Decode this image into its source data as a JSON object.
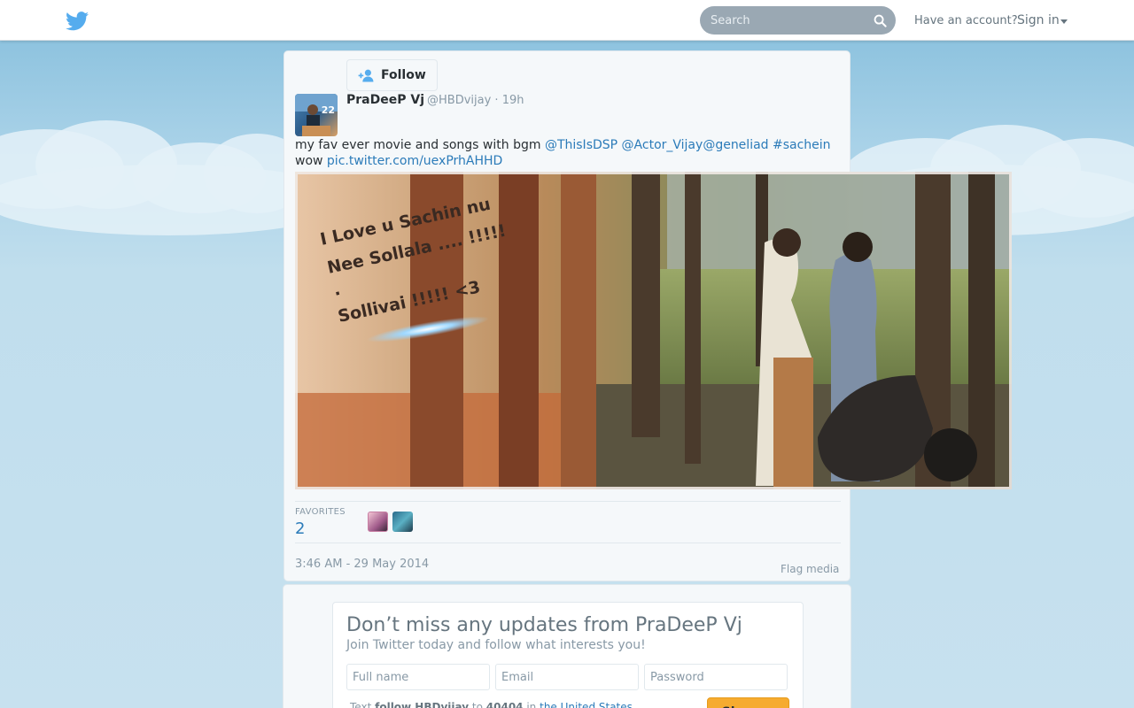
{
  "topbar": {
    "search": {
      "placeholder": "Search"
    },
    "have_account": "Have an account?",
    "signin_label": "Sign in"
  },
  "tweet": {
    "follow_label": "Follow",
    "fullname": "PraDeeP Vj",
    "username": "@HBDvijay",
    "time_ago": "19h",
    "avatar_number": "22",
    "text_plain_1": "my fav ever movie and songs with bgm ",
    "mention_1": "@ThisIsDSP",
    "mention_2": "@Actor_Vijay",
    "mention_3": "@geneliad",
    "hashtag": "#sachein",
    "text_plain_2": "wow ",
    "pic_link": "pic.twitter.com/uexPrhAHHD",
    "media_overlay_lines": [
      "I Love u Sachin nu",
      "Nee Sollala .... !!!!!",
      ".",
      "Sollivai !!!!! <3"
    ],
    "favorites_label": "FAVORITES",
    "favorites_count": "2",
    "timestamp": "3:46 AM - 29 May 2014",
    "flag_label": "Flag media"
  },
  "signup": {
    "title": "Don’t miss any updates from PraDeeP Vj",
    "subtitle": "Join Twitter today and follow what interests you!",
    "fullname_placeholder": "Full name",
    "email_placeholder": "Email",
    "password_placeholder": "Password",
    "sms_text": "Text",
    "sms_command": "follow HBDvijay",
    "sms_to": "to",
    "sms_number": "40404",
    "sms_in": "in",
    "sms_country": "the United States",
    "button_label": "Sign up"
  },
  "colors": {
    "link": "#2b7bb9",
    "twitter_blue": "#55acee",
    "signup_button": "#f6ab2f"
  }
}
